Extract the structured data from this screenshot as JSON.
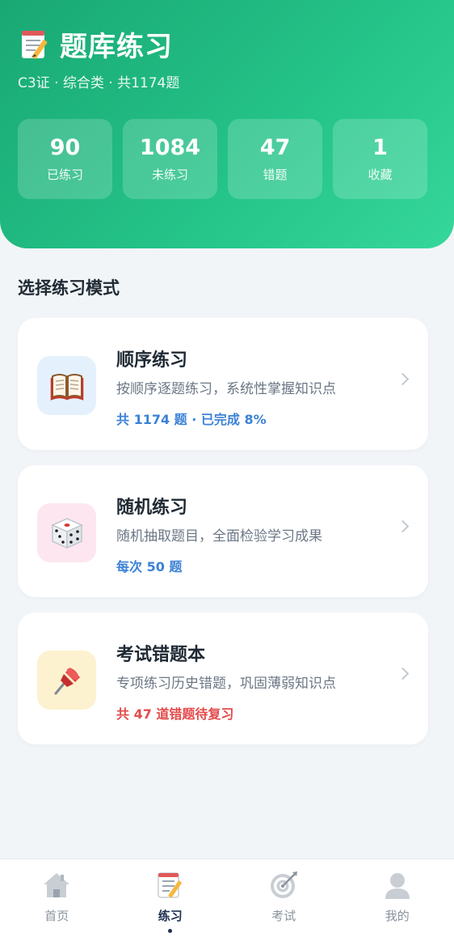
{
  "header": {
    "title": "题库练习",
    "subtitle": "C3证 · 综合类 · 共1174题",
    "title_icon": "memo-icon",
    "stats": [
      {
        "value": "90",
        "label": "已练习"
      },
      {
        "value": "1084",
        "label": "未练习"
      },
      {
        "value": "47",
        "label": "错题"
      },
      {
        "value": "1",
        "label": "收藏"
      }
    ]
  },
  "section_title": "选择练习模式",
  "modes": [
    {
      "title": "顺序练习",
      "desc": "按顺序逐题练习，系统性掌握知识点",
      "meta": "共 1174 题 · 已完成 8%",
      "icon": "book-icon",
      "icon_bg": "#e4f1fd",
      "meta_color": "#3b82d6"
    },
    {
      "title": "随机练习",
      "desc": "随机抽取题目，全面检验学习成果",
      "meta": "每次 50 题",
      "icon": "dice-icon",
      "icon_bg": "#fde6ef",
      "meta_color": "#3b82d6"
    },
    {
      "title": "考试错题本",
      "desc": "专项练习历史错题，巩固薄弱知识点",
      "meta": "共 47 道错题待复习",
      "icon": "pushpin-icon",
      "icon_bg": "#fdf2cf",
      "meta_color": "#e34b4b"
    }
  ],
  "tabbar": {
    "items": [
      {
        "label": "首页",
        "icon": "house-icon",
        "active": false
      },
      {
        "label": "练习",
        "icon": "memo-icon",
        "active": true
      },
      {
        "label": "考试",
        "icon": "target-icon",
        "active": false
      },
      {
        "label": "我的",
        "icon": "user-icon",
        "active": false
      }
    ]
  },
  "colors": {
    "header_start": "#19a874",
    "header_end": "#36d79b",
    "accent_blue": "#3b82d6",
    "accent_red": "#e34b4b"
  }
}
